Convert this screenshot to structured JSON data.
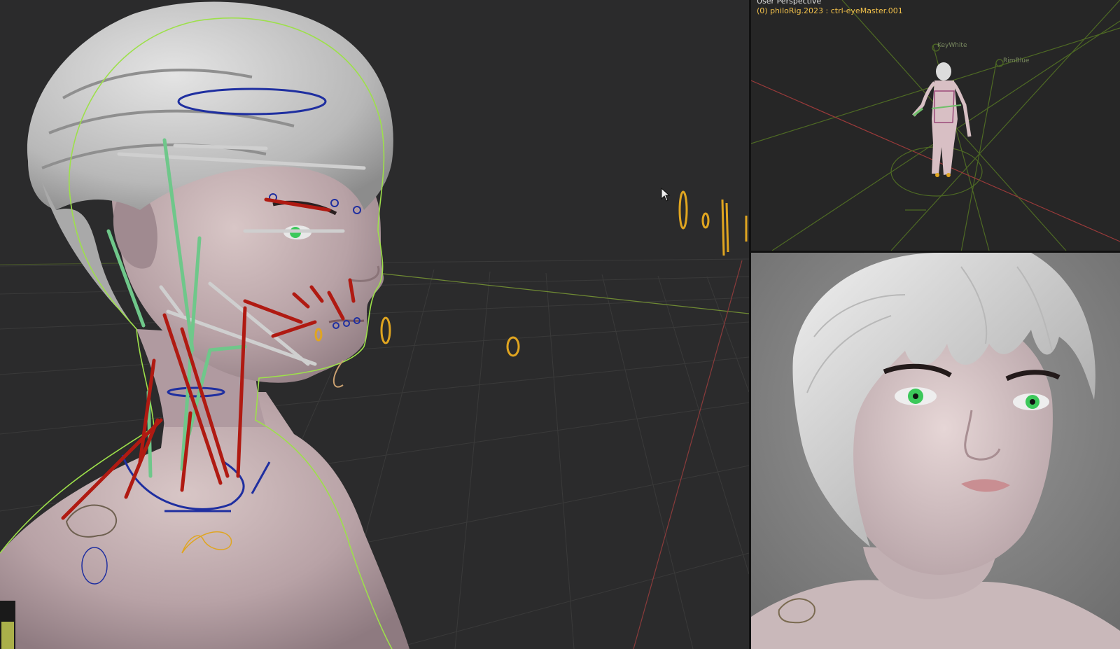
{
  "viewport_top": {
    "title": "User Perspective",
    "active_object": "(0) philoRig.2023 : ctrl-eyeMaster.001",
    "labels": [
      "KeyWhite",
      "RimBlue"
    ]
  },
  "icons": {
    "cursor": "mouse-pointer-icon",
    "corner": "viewport-corner-icon"
  },
  "colors": {
    "hud_title": "#e6e6e6",
    "hud_object": "#f2c14b",
    "selection_outline": "#9de04a",
    "bone_red": "#b01a12",
    "bone_green": "#6fc78a",
    "bone_blue": "#1f2fa0",
    "bone_yellow": "#e0a520",
    "grid": "#3a3a3a"
  }
}
